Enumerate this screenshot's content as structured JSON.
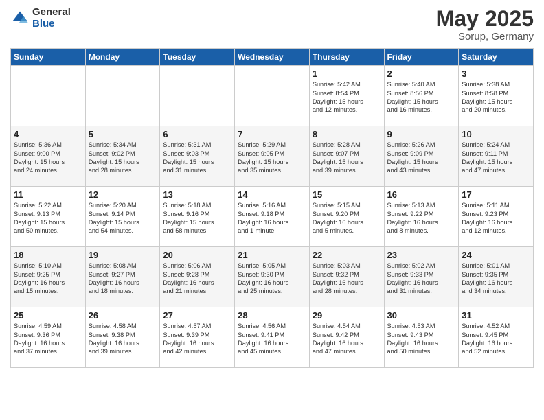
{
  "logo": {
    "general": "General",
    "blue": "Blue"
  },
  "title": "May 2025",
  "subtitle": "Sorup, Germany",
  "headers": [
    "Sunday",
    "Monday",
    "Tuesday",
    "Wednesday",
    "Thursday",
    "Friday",
    "Saturday"
  ],
  "weeks": [
    [
      {
        "day": "",
        "content": ""
      },
      {
        "day": "",
        "content": ""
      },
      {
        "day": "",
        "content": ""
      },
      {
        "day": "",
        "content": ""
      },
      {
        "day": "1",
        "content": "Sunrise: 5:42 AM\nSunset: 8:54 PM\nDaylight: 15 hours\nand 12 minutes."
      },
      {
        "day": "2",
        "content": "Sunrise: 5:40 AM\nSunset: 8:56 PM\nDaylight: 15 hours\nand 16 minutes."
      },
      {
        "day": "3",
        "content": "Sunrise: 5:38 AM\nSunset: 8:58 PM\nDaylight: 15 hours\nand 20 minutes."
      }
    ],
    [
      {
        "day": "4",
        "content": "Sunrise: 5:36 AM\nSunset: 9:00 PM\nDaylight: 15 hours\nand 24 minutes."
      },
      {
        "day": "5",
        "content": "Sunrise: 5:34 AM\nSunset: 9:02 PM\nDaylight: 15 hours\nand 28 minutes."
      },
      {
        "day": "6",
        "content": "Sunrise: 5:31 AM\nSunset: 9:03 PM\nDaylight: 15 hours\nand 31 minutes."
      },
      {
        "day": "7",
        "content": "Sunrise: 5:29 AM\nSunset: 9:05 PM\nDaylight: 15 hours\nand 35 minutes."
      },
      {
        "day": "8",
        "content": "Sunrise: 5:28 AM\nSunset: 9:07 PM\nDaylight: 15 hours\nand 39 minutes."
      },
      {
        "day": "9",
        "content": "Sunrise: 5:26 AM\nSunset: 9:09 PM\nDaylight: 15 hours\nand 43 minutes."
      },
      {
        "day": "10",
        "content": "Sunrise: 5:24 AM\nSunset: 9:11 PM\nDaylight: 15 hours\nand 47 minutes."
      }
    ],
    [
      {
        "day": "11",
        "content": "Sunrise: 5:22 AM\nSunset: 9:13 PM\nDaylight: 15 hours\nand 50 minutes."
      },
      {
        "day": "12",
        "content": "Sunrise: 5:20 AM\nSunset: 9:14 PM\nDaylight: 15 hours\nand 54 minutes."
      },
      {
        "day": "13",
        "content": "Sunrise: 5:18 AM\nSunset: 9:16 PM\nDaylight: 15 hours\nand 58 minutes."
      },
      {
        "day": "14",
        "content": "Sunrise: 5:16 AM\nSunset: 9:18 PM\nDaylight: 16 hours\nand 1 minute."
      },
      {
        "day": "15",
        "content": "Sunrise: 5:15 AM\nSunset: 9:20 PM\nDaylight: 16 hours\nand 5 minutes."
      },
      {
        "day": "16",
        "content": "Sunrise: 5:13 AM\nSunset: 9:22 PM\nDaylight: 16 hours\nand 8 minutes."
      },
      {
        "day": "17",
        "content": "Sunrise: 5:11 AM\nSunset: 9:23 PM\nDaylight: 16 hours\nand 12 minutes."
      }
    ],
    [
      {
        "day": "18",
        "content": "Sunrise: 5:10 AM\nSunset: 9:25 PM\nDaylight: 16 hours\nand 15 minutes."
      },
      {
        "day": "19",
        "content": "Sunrise: 5:08 AM\nSunset: 9:27 PM\nDaylight: 16 hours\nand 18 minutes."
      },
      {
        "day": "20",
        "content": "Sunrise: 5:06 AM\nSunset: 9:28 PM\nDaylight: 16 hours\nand 21 minutes."
      },
      {
        "day": "21",
        "content": "Sunrise: 5:05 AM\nSunset: 9:30 PM\nDaylight: 16 hours\nand 25 minutes."
      },
      {
        "day": "22",
        "content": "Sunrise: 5:03 AM\nSunset: 9:32 PM\nDaylight: 16 hours\nand 28 minutes."
      },
      {
        "day": "23",
        "content": "Sunrise: 5:02 AM\nSunset: 9:33 PM\nDaylight: 16 hours\nand 31 minutes."
      },
      {
        "day": "24",
        "content": "Sunrise: 5:01 AM\nSunset: 9:35 PM\nDaylight: 16 hours\nand 34 minutes."
      }
    ],
    [
      {
        "day": "25",
        "content": "Sunrise: 4:59 AM\nSunset: 9:36 PM\nDaylight: 16 hours\nand 37 minutes."
      },
      {
        "day": "26",
        "content": "Sunrise: 4:58 AM\nSunset: 9:38 PM\nDaylight: 16 hours\nand 39 minutes."
      },
      {
        "day": "27",
        "content": "Sunrise: 4:57 AM\nSunset: 9:39 PM\nDaylight: 16 hours\nand 42 minutes."
      },
      {
        "day": "28",
        "content": "Sunrise: 4:56 AM\nSunset: 9:41 PM\nDaylight: 16 hours\nand 45 minutes."
      },
      {
        "day": "29",
        "content": "Sunrise: 4:54 AM\nSunset: 9:42 PM\nDaylight: 16 hours\nand 47 minutes."
      },
      {
        "day": "30",
        "content": "Sunrise: 4:53 AM\nSunset: 9:43 PM\nDaylight: 16 hours\nand 50 minutes."
      },
      {
        "day": "31",
        "content": "Sunrise: 4:52 AM\nSunset: 9:45 PM\nDaylight: 16 hours\nand 52 minutes."
      }
    ]
  ]
}
